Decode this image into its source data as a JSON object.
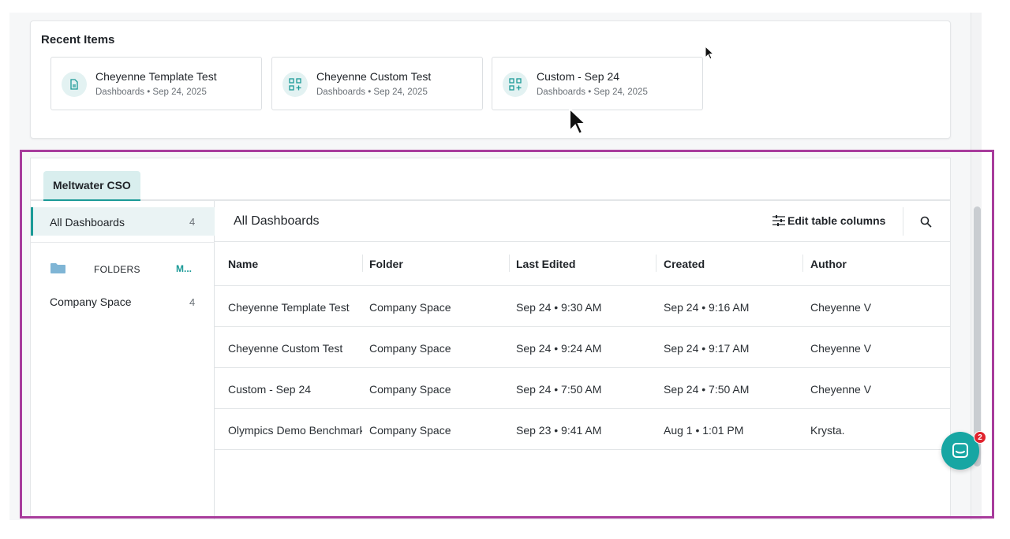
{
  "recent": {
    "title": "Recent Items",
    "items": [
      {
        "name": "Cheyenne Template Test",
        "meta": "Dashboards • Sep 24, 2025",
        "icon": "document-icon"
      },
      {
        "name": "Cheyenne Custom Test",
        "meta": "Dashboards • Sep 24, 2025",
        "icon": "grid-add-icon"
      },
      {
        "name": "Custom - Sep 24",
        "meta": "Dashboards • Sep 24, 2025",
        "icon": "grid-add-icon"
      }
    ]
  },
  "workspace": {
    "tab_label": "Meltwater CSO"
  },
  "sidebar": {
    "all_dashboards_label": "All Dashboards",
    "all_dashboards_count": "4",
    "folders_label": "FOLDERS",
    "folders_more": "M...",
    "folder_items": [
      {
        "label": "Company Space",
        "count": "4"
      }
    ]
  },
  "main": {
    "title": "All Dashboards",
    "edit_columns_label": "Edit table columns",
    "columns": [
      "Name",
      "Folder",
      "Last Edited",
      "Created",
      "Author"
    ],
    "rows": [
      [
        "Cheyenne Template Test",
        "Company Space",
        "Sep 24 • 9:30 AM",
        "Sep 24 • 9:16 AM",
        "Cheyenne V"
      ],
      [
        "Cheyenne Custom Test",
        "Company Space",
        "Sep 24 • 9:24 AM",
        "Sep 24 • 9:17 AM",
        "Cheyenne V"
      ],
      [
        "Custom - Sep 24",
        "Company Space",
        "Sep 24 • 7:50 AM",
        "Sep 24 • 7:50 AM",
        "Cheyenne V"
      ],
      [
        "Olympics Demo Benchmark",
        "Company Space",
        "Sep 23 • 9:41 AM",
        "Aug 1 • 1:01 PM",
        "Krysta."
      ]
    ]
  },
  "chat": {
    "badge_count": "2"
  },
  "colors": {
    "accent": "#1b9a97",
    "highlight": "#a83c9c",
    "badge": "#e0232e"
  }
}
